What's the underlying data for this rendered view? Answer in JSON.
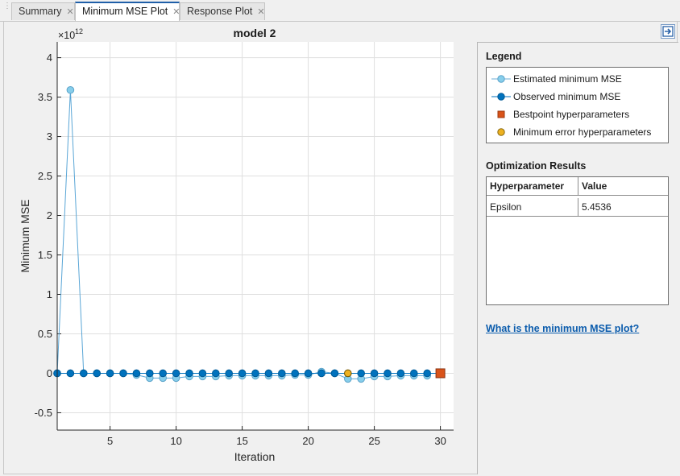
{
  "tabs": [
    {
      "label": "Summary",
      "active": false
    },
    {
      "label": "Minimum MSE Plot",
      "active": true
    },
    {
      "label": "Response Plot",
      "active": false
    }
  ],
  "plot": {
    "title": "model 2",
    "xlabel": "Iteration",
    "ylabel": "Minimum MSE",
    "exponent_base": "×10",
    "exponent_power": "12"
  },
  "chart_data": {
    "type": "line",
    "title": "model 2",
    "xlabel": "Iteration",
    "ylabel": "Minimum MSE",
    "y_scale_multiplier": "1e12",
    "xlim": [
      1,
      31
    ],
    "ylim": [
      -0.72,
      4.2
    ],
    "xticks": [
      5,
      10,
      15,
      20,
      25,
      30
    ],
    "yticks": [
      -0.5,
      0,
      0.5,
      1,
      1.5,
      2,
      2.5,
      3,
      3.5,
      4
    ],
    "ytick_labels": [
      "-0.5",
      "0",
      "0.5",
      "1",
      "1.5",
      "2",
      "2.5",
      "3",
      "3.5",
      "4"
    ],
    "grid": true,
    "series": [
      {
        "name": "Estimated minimum MSE",
        "color": "#87ceeb",
        "x": [
          1,
          2,
          3,
          4,
          5,
          6,
          7,
          8,
          9,
          10,
          11,
          12,
          13,
          14,
          15,
          16,
          17,
          18,
          19,
          20,
          21,
          22,
          23,
          24,
          25,
          26,
          27,
          28,
          29
        ],
        "values": [
          0,
          3.59,
          0,
          0,
          0,
          0,
          -0.02,
          -0.06,
          -0.06,
          -0.06,
          -0.04,
          -0.04,
          -0.04,
          -0.03,
          -0.03,
          -0.03,
          -0.03,
          -0.03,
          -0.02,
          -0.02,
          0.02,
          0,
          -0.07,
          -0.07,
          -0.04,
          -0.04,
          -0.03,
          -0.03,
          -0.03
        ]
      },
      {
        "name": "Observed minimum MSE",
        "color": "#0072bd",
        "x": [
          1,
          2,
          3,
          4,
          5,
          6,
          7,
          8,
          9,
          10,
          11,
          12,
          13,
          14,
          15,
          16,
          17,
          18,
          19,
          20,
          21,
          22,
          23,
          24,
          25,
          26,
          27,
          28,
          29,
          30
        ],
        "values": [
          0,
          0,
          0,
          0,
          0,
          0,
          0,
          0,
          0,
          0,
          0,
          0,
          0,
          0,
          0,
          0,
          0,
          0,
          0,
          0,
          0,
          0,
          0,
          0,
          0,
          0,
          0,
          0,
          0,
          0
        ]
      }
    ],
    "bestpoint": {
      "name": "Bestpoint hyperparameters",
      "x": 30,
      "y": 0,
      "color": "#d95319"
    },
    "min_error": {
      "name": "Minimum error hyperparameters",
      "x": 23,
      "y": 0,
      "color": "#edb120"
    }
  },
  "legend": {
    "title": "Legend",
    "items": [
      {
        "label": "Estimated minimum MSE",
        "symbol": "est-line",
        "color": "#87ceeb"
      },
      {
        "label": "Observed minimum MSE",
        "symbol": "obs-line",
        "color": "#0072bd"
      },
      {
        "label": "Bestpoint hyperparameters",
        "symbol": "square",
        "color": "#d95319"
      },
      {
        "label": "Minimum error hyperparameters",
        "symbol": "circle",
        "color": "#edb120"
      }
    ]
  },
  "results": {
    "title": "Optimization Results",
    "columns": [
      "Hyperparameter",
      "Value"
    ],
    "rows": [
      [
        "Epsilon",
        "5.4536"
      ]
    ]
  },
  "help_link": "What is the minimum MSE plot?",
  "dock_button_icon": "undock-arrow-icon"
}
